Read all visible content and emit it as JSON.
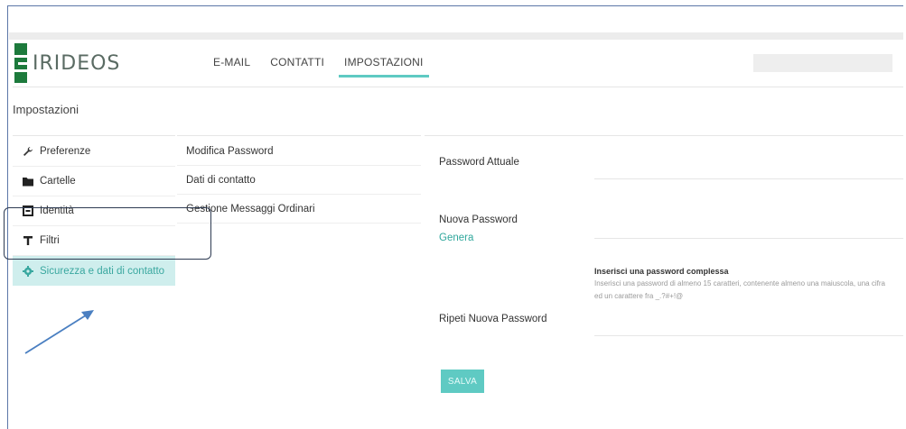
{
  "header": {
    "logo_text": "IRIDEOS",
    "nav": [
      {
        "label": "E-MAIL",
        "active": false
      },
      {
        "label": "CONTATTI",
        "active": false
      },
      {
        "label": "IMPOSTAZIONI",
        "active": true
      }
    ]
  },
  "page_title": "Impostazioni",
  "sidebar": {
    "items": [
      {
        "label": "Preferenze",
        "icon": "wrench-icon"
      },
      {
        "label": "Cartelle",
        "icon": "folder-icon"
      },
      {
        "label": "Identità",
        "icon": "identity-icon"
      },
      {
        "label": "Filtri",
        "icon": "filter-icon"
      },
      {
        "label": "Sicurezza e dati di contatto",
        "icon": "gear-icon",
        "active": true
      }
    ]
  },
  "submenu": {
    "items": [
      {
        "label": "Modifica Password"
      },
      {
        "label": "Dati di contatto"
      },
      {
        "label": "Gestione Messaggi Ordinari"
      }
    ]
  },
  "form": {
    "current_password_label": "Password Attuale",
    "new_password_label": "Nuova Password",
    "generate_link": "Genera",
    "hint_title": "Inserisci una password complessa",
    "hint_body": "Inserisci una password di almeno 15 caratteri, contenente almeno una maiuscola, una cifra ed un carattere fra _.?#+!@",
    "repeat_password_label": "Ripeti Nuova Password",
    "save_label": "SALVA"
  },
  "colors": {
    "brand_green": "#1d7a3c",
    "accent_teal": "#5fcac3",
    "active_bg": "#cfeeed",
    "link_teal": "#2fa79c",
    "callout_border": "#2e3b52",
    "arrow_blue": "#4a7fc1"
  }
}
